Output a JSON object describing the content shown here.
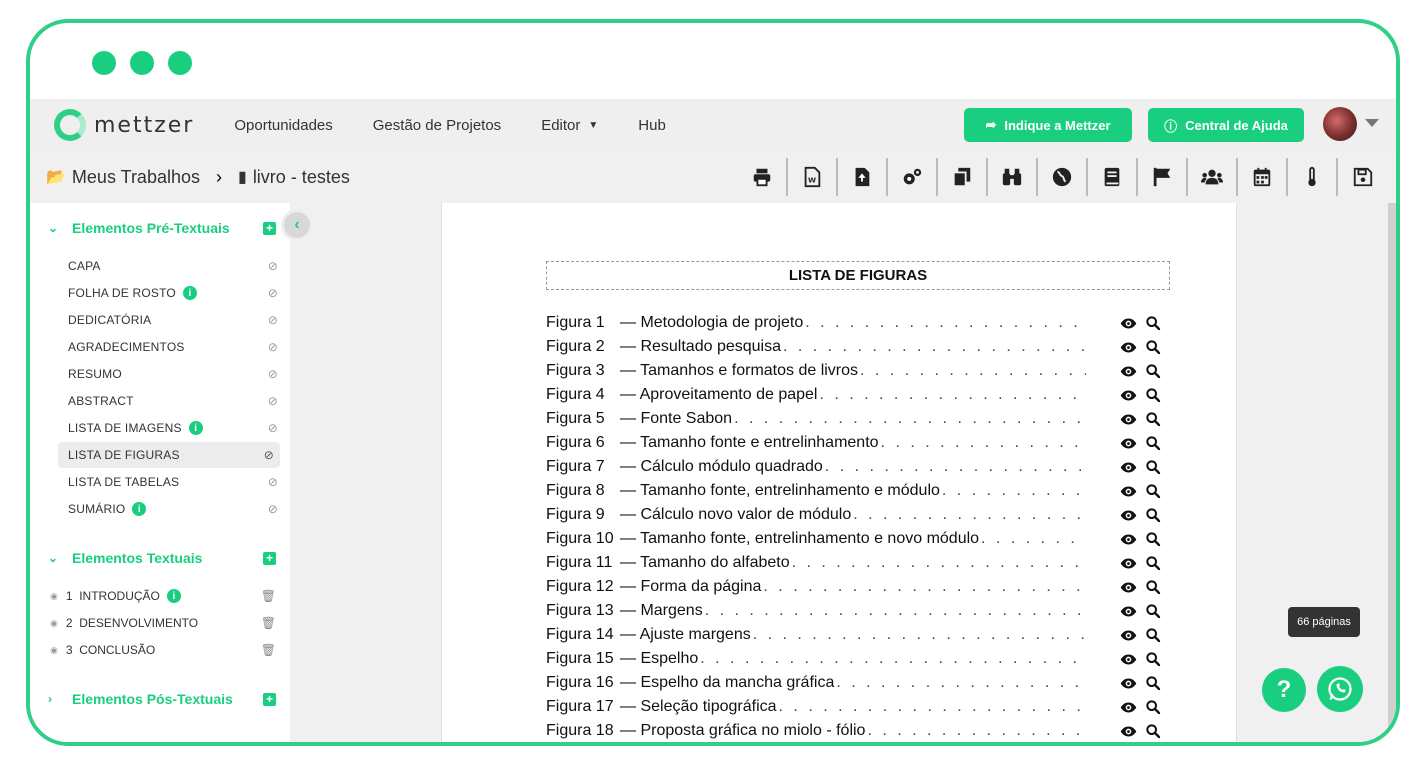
{
  "nav": {
    "logo": "mettzer",
    "items": [
      "Oportunidades",
      "Gestão de Projetos",
      "Editor",
      "Hub"
    ],
    "indique": "Indique a Mettzer",
    "central": "Central de Ajuda"
  },
  "breadcrumb": {
    "root": "Meus Trabalhos",
    "current": "livro - testes"
  },
  "toolbar": [
    "print-icon",
    "word-export-icon",
    "file-upload-icon",
    "settings-gears-icon",
    "copy-icon",
    "binoculars-icon",
    "globe-icon",
    "book-icon",
    "flag-icon",
    "users-icon",
    "calendar-icon",
    "thermometer-icon",
    "save-icon"
  ],
  "sidebar": {
    "pre_title": "Elementos Pré-Textuais",
    "pre_items": [
      {
        "label": "CAPA",
        "info": false
      },
      {
        "label": "FOLHA DE ROSTO",
        "info": true
      },
      {
        "label": "DEDICATÓRIA",
        "info": false
      },
      {
        "label": "AGRADECIMENTOS",
        "info": false
      },
      {
        "label": "RESUMO",
        "info": false
      },
      {
        "label": "ABSTRACT",
        "info": false
      },
      {
        "label": "LISTA DE IMAGENS",
        "info": true
      },
      {
        "label": "LISTA DE FIGURAS",
        "info": false
      },
      {
        "label": "LISTA DE TABELAS",
        "info": false
      },
      {
        "label": "SUMÁRIO",
        "info": true
      }
    ],
    "txt_title": "Elementos Textuais",
    "txt_items": [
      {
        "label": "1  INTRODUÇÃO",
        "info": true
      },
      {
        "label": "2  DESENVOLVIMENTO",
        "info": false
      },
      {
        "label": "3  CONCLUSÃO",
        "info": false
      }
    ],
    "post_title": "Elementos Pós-Textuais"
  },
  "document": {
    "title": "LISTA DE FIGURAS",
    "figures": [
      {
        "num": "Figura 1",
        "text": "— Metodologia de projeto"
      },
      {
        "num": "Figura 2",
        "text": "— Resultado pesquisa"
      },
      {
        "num": "Figura 3",
        "text": "— Tamanhos e formatos de livros"
      },
      {
        "num": "Figura 4",
        "text": "— Aproveitamento de papel"
      },
      {
        "num": "Figura 5",
        "text": "— Fonte Sabon"
      },
      {
        "num": "Figura 6",
        "text": "— Tamanho fonte e entrelinhamento"
      },
      {
        "num": "Figura 7",
        "text": "— Cálculo módulo quadrado"
      },
      {
        "num": "Figura 8",
        "text": "— Tamanho fonte, entrelinhamento e módulo"
      },
      {
        "num": "Figura 9",
        "text": "— Cálculo novo valor de módulo"
      },
      {
        "num": "Figura 10",
        "text": "— Tamanho fonte, entrelinhamento e novo módulo"
      },
      {
        "num": "Figura 11",
        "text": "— Tamanho do alfabeto"
      },
      {
        "num": "Figura 12",
        "text": "— Forma da página"
      },
      {
        "num": "Figura 13",
        "text": "— Margens"
      },
      {
        "num": "Figura 14",
        "text": "— Ajuste margens"
      },
      {
        "num": "Figura 15",
        "text": "— Espelho"
      },
      {
        "num": "Figura 16",
        "text": "— Espelho da mancha gráfica"
      },
      {
        "num": "Figura 17",
        "text": "— Seleção tipográfica"
      },
      {
        "num": "Figura 18",
        "text": "— Proposta gráfica no miolo - fólio"
      }
    ]
  },
  "pages_badge": "66 páginas",
  "colors": {
    "accent": "#19cf7f",
    "frame": "#2fd086"
  }
}
